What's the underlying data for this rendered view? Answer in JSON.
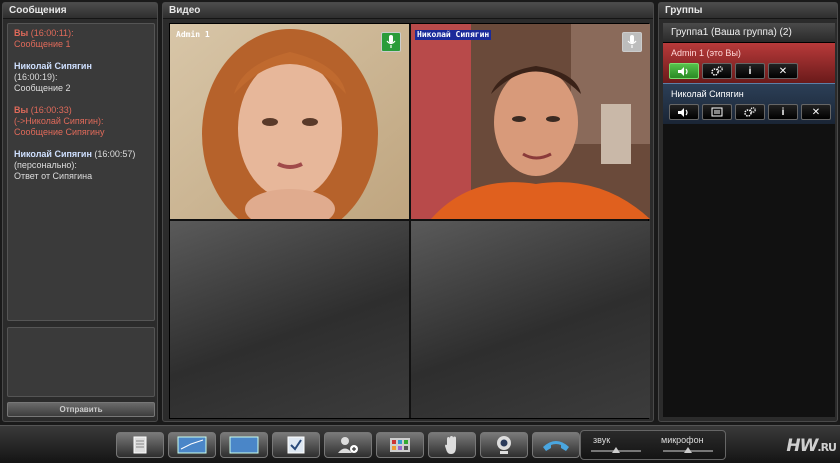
{
  "messages_panel": {
    "title": "Сообщения",
    "send_label": "Отправить",
    "messages": [
      {
        "author": "Вы",
        "time": "(16:00:11):",
        "meta": "",
        "text": "Сообщение 1",
        "self": true
      },
      {
        "author": "Николай Сипягин",
        "time": "(16:00:19):",
        "meta": "",
        "text": "Сообщение 2",
        "self": false
      },
      {
        "author": "Вы",
        "time": "(16:00:33)",
        "meta": "(->Николай Сипягин):",
        "text": "Сообщение Сипягину",
        "self": true
      },
      {
        "author": "Николай Сипягин",
        "time": "(16:00:57)",
        "meta": "(персонально):",
        "text": "Ответ от Сипягина",
        "self": false
      }
    ]
  },
  "video_panel": {
    "title": "Видео",
    "feeds": [
      {
        "label": "Admin 1",
        "mic": "on"
      },
      {
        "label": "Николай Сипягин",
        "mic": "off"
      }
    ]
  },
  "groups_panel": {
    "title": "Группы",
    "group_title": "Группа1 (Ваша группа) (2)",
    "members": [
      {
        "name": "Admin 1 (это Вы)",
        "info_label": "i",
        "remove_label": "✕"
      },
      {
        "name": "Николай Сипягин",
        "info_label": "i",
        "remove_label": "✕"
      }
    ]
  },
  "toolbar": {
    "sound_label": "звук",
    "mic_label": "микрофон",
    "sound_level": 0.5,
    "mic_level": 0.5,
    "logo_main": "HW",
    "logo_suffix": ".RU"
  },
  "colors": {
    "self_message": "#e06a5a",
    "self_member_bg": "#b83a3a",
    "other_member_bg": "#2c3f57",
    "mic_on": "#2a9c3a"
  }
}
